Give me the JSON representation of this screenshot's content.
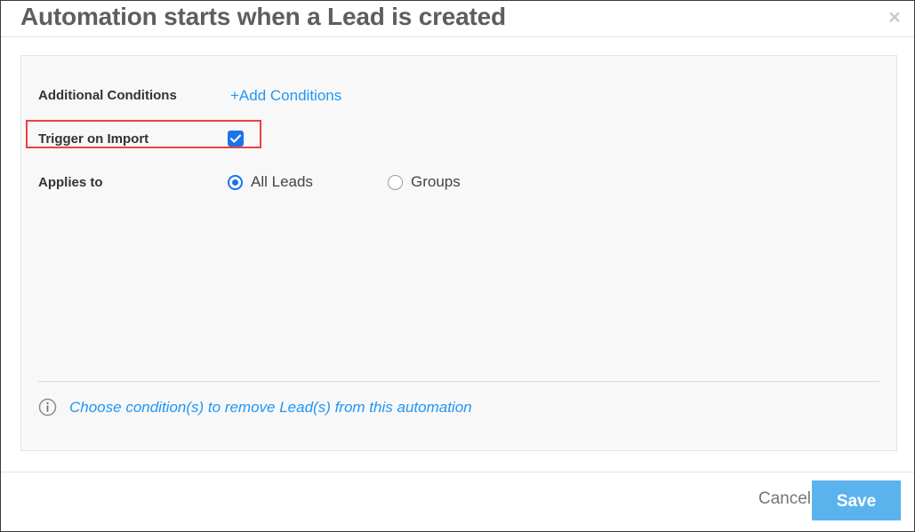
{
  "dialog": {
    "title": "Automation starts when a Lead is created",
    "close_label": "×",
    "close_icon": "close-icon"
  },
  "form": {
    "additional_conditions": {
      "label": "Additional Conditions",
      "add_link": "+Add Conditions"
    },
    "trigger_on_import": {
      "label": "Trigger on Import",
      "checked": true,
      "checkbox_icon": "checkbox-checked-icon"
    },
    "applies_to": {
      "label": "Applies to",
      "options": [
        {
          "label": "All Leads",
          "selected": true
        },
        {
          "label": "Groups",
          "selected": false
        }
      ]
    }
  },
  "note": {
    "icon": "info-circle-icon",
    "text": "Choose condition(s) to remove Lead(s) from this automation"
  },
  "footer": {
    "cancel_label": "Cancel",
    "save_label": "Save"
  },
  "colors": {
    "accent_blue": "#2196f3",
    "control_blue": "#1a73e8",
    "save_blue": "#5bb3ee",
    "highlight_red": "#ef3e42",
    "panel_bg": "#f8f8f8",
    "title_gray": "#5e5e5e"
  }
}
